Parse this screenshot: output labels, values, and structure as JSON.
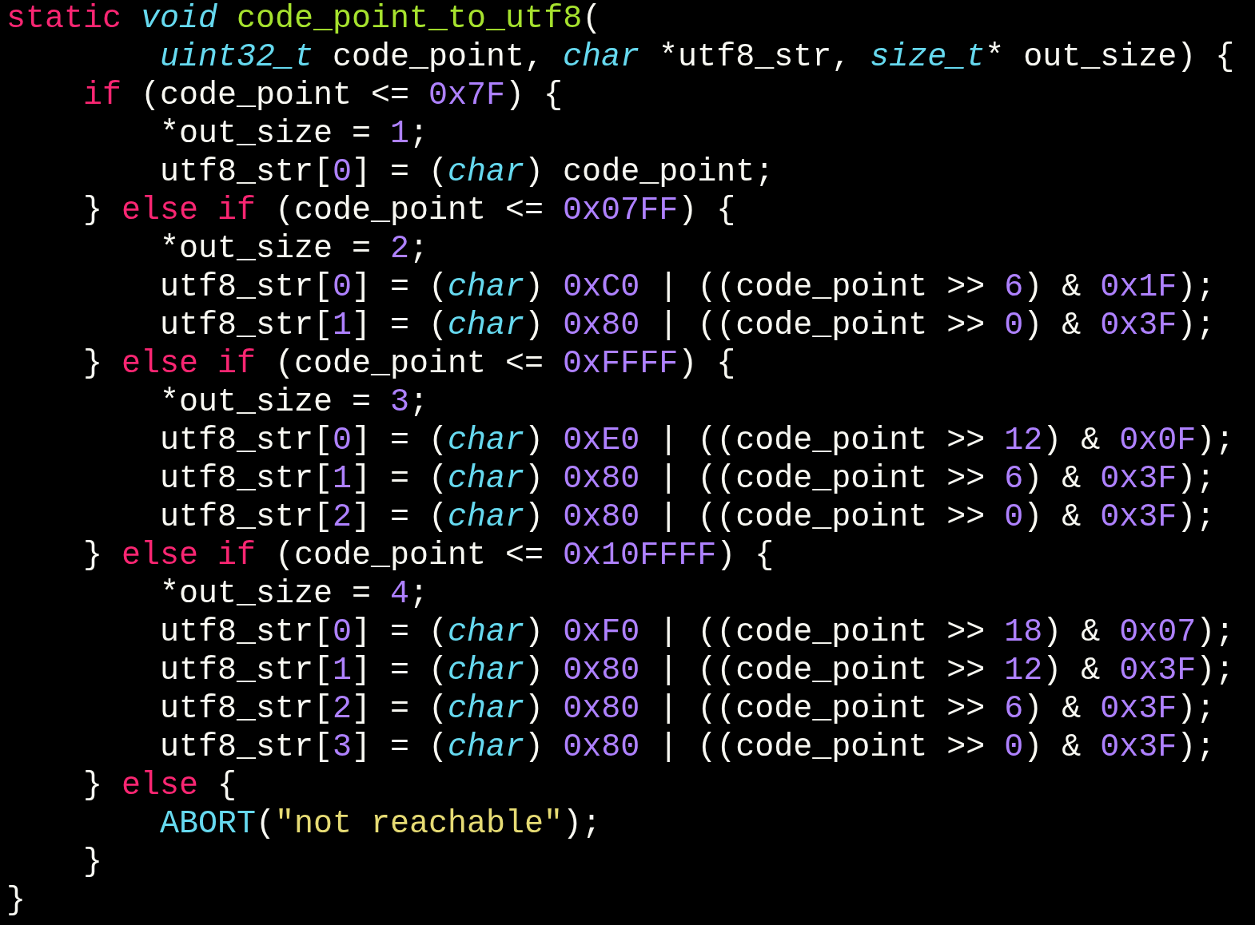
{
  "code_lines": [
    {
      "kind": "top",
      "tokens": [
        {
          "kind": "keyword",
          "text": "static "
        },
        {
          "kind": "type",
          "text": "void "
        },
        {
          "kind": "function",
          "text": "code_point_to_utf8"
        },
        {
          "kind": "plain",
          "text": "("
        }
      ]
    },
    {
      "kind": "inner",
      "tokens": [
        {
          "kind": "type",
          "text": "uint32_t"
        },
        {
          "kind": "plain",
          "text": " code_point, "
        },
        {
          "kind": "type",
          "text": "char"
        },
        {
          "kind": "plain",
          "text": " *utf8_str, "
        },
        {
          "kind": "type",
          "text": "size_t"
        },
        {
          "kind": "plain",
          "text": "* out_size) {"
        }
      ]
    },
    {
      "kind": "outer",
      "tokens": [
        {
          "kind": "keyword",
          "text": "if "
        },
        {
          "kind": "plain",
          "text": "(code_point <= "
        },
        {
          "kind": "number",
          "text": "0x7F"
        },
        {
          "kind": "plain",
          "text": ") {"
        }
      ]
    },
    {
      "kind": "inner",
      "tokens": [
        {
          "kind": "plain",
          "text": "*out_size = "
        },
        {
          "kind": "number",
          "text": "1"
        },
        {
          "kind": "plain",
          "text": ";"
        }
      ]
    },
    {
      "kind": "inner",
      "tokens": [
        {
          "kind": "plain",
          "text": "utf8_str["
        },
        {
          "kind": "number",
          "text": "0"
        },
        {
          "kind": "plain",
          "text": "] = ("
        },
        {
          "kind": "type",
          "text": "char"
        },
        {
          "kind": "plain",
          "text": ") code_point;"
        }
      ]
    },
    {
      "kind": "outer",
      "tokens": [
        {
          "kind": "plain",
          "text": "} "
        },
        {
          "kind": "keyword",
          "text": "else if "
        },
        {
          "kind": "plain",
          "text": "(code_point <= "
        },
        {
          "kind": "number",
          "text": "0x07FF"
        },
        {
          "kind": "plain",
          "text": ") {"
        }
      ]
    },
    {
      "kind": "inner",
      "tokens": [
        {
          "kind": "plain",
          "text": "*out_size = "
        },
        {
          "kind": "number",
          "text": "2"
        },
        {
          "kind": "plain",
          "text": ";"
        }
      ]
    },
    {
      "kind": "inner",
      "tokens": [
        {
          "kind": "plain",
          "text": "utf8_str["
        },
        {
          "kind": "number",
          "text": "0"
        },
        {
          "kind": "plain",
          "text": "] = ("
        },
        {
          "kind": "type",
          "text": "char"
        },
        {
          "kind": "plain",
          "text": ") "
        },
        {
          "kind": "number",
          "text": "0xC0"
        },
        {
          "kind": "plain",
          "text": " | ((code_point >> "
        },
        {
          "kind": "number",
          "text": "6"
        },
        {
          "kind": "plain",
          "text": ") & "
        },
        {
          "kind": "number",
          "text": "0x1F"
        },
        {
          "kind": "plain",
          "text": ");"
        }
      ]
    },
    {
      "kind": "inner",
      "tokens": [
        {
          "kind": "plain",
          "text": "utf8_str["
        },
        {
          "kind": "number",
          "text": "1"
        },
        {
          "kind": "plain",
          "text": "] = ("
        },
        {
          "kind": "type",
          "text": "char"
        },
        {
          "kind": "plain",
          "text": ") "
        },
        {
          "kind": "number",
          "text": "0x80"
        },
        {
          "kind": "plain",
          "text": " | ((code_point >> "
        },
        {
          "kind": "number",
          "text": "0"
        },
        {
          "kind": "plain",
          "text": ") & "
        },
        {
          "kind": "number",
          "text": "0x3F"
        },
        {
          "kind": "plain",
          "text": ");"
        }
      ]
    },
    {
      "kind": "outer",
      "tokens": [
        {
          "kind": "plain",
          "text": "} "
        },
        {
          "kind": "keyword",
          "text": "else if "
        },
        {
          "kind": "plain",
          "text": "(code_point <= "
        },
        {
          "kind": "number",
          "text": "0xFFFF"
        },
        {
          "kind": "plain",
          "text": ") {"
        }
      ]
    },
    {
      "kind": "inner",
      "tokens": [
        {
          "kind": "plain",
          "text": "*out_size = "
        },
        {
          "kind": "number",
          "text": "3"
        },
        {
          "kind": "plain",
          "text": ";"
        }
      ]
    },
    {
      "kind": "inner",
      "tokens": [
        {
          "kind": "plain",
          "text": "utf8_str["
        },
        {
          "kind": "number",
          "text": "0"
        },
        {
          "kind": "plain",
          "text": "] = ("
        },
        {
          "kind": "type",
          "text": "char"
        },
        {
          "kind": "plain",
          "text": ") "
        },
        {
          "kind": "number",
          "text": "0xE0"
        },
        {
          "kind": "plain",
          "text": " | ((code_point >> "
        },
        {
          "kind": "number",
          "text": "12"
        },
        {
          "kind": "plain",
          "text": ") & "
        },
        {
          "kind": "number",
          "text": "0x0F"
        },
        {
          "kind": "plain",
          "text": ");"
        }
      ]
    },
    {
      "kind": "inner",
      "tokens": [
        {
          "kind": "plain",
          "text": "utf8_str["
        },
        {
          "kind": "number",
          "text": "1"
        },
        {
          "kind": "plain",
          "text": "] = ("
        },
        {
          "kind": "type",
          "text": "char"
        },
        {
          "kind": "plain",
          "text": ") "
        },
        {
          "kind": "number",
          "text": "0x80"
        },
        {
          "kind": "plain",
          "text": " | ((code_point >> "
        },
        {
          "kind": "number",
          "text": "6"
        },
        {
          "kind": "plain",
          "text": ") & "
        },
        {
          "kind": "number",
          "text": "0x3F"
        },
        {
          "kind": "plain",
          "text": ");"
        }
      ]
    },
    {
      "kind": "inner",
      "tokens": [
        {
          "kind": "plain",
          "text": "utf8_str["
        },
        {
          "kind": "number",
          "text": "2"
        },
        {
          "kind": "plain",
          "text": "] = ("
        },
        {
          "kind": "type",
          "text": "char"
        },
        {
          "kind": "plain",
          "text": ") "
        },
        {
          "kind": "number",
          "text": "0x80"
        },
        {
          "kind": "plain",
          "text": " | ((code_point >> "
        },
        {
          "kind": "number",
          "text": "0"
        },
        {
          "kind": "plain",
          "text": ") & "
        },
        {
          "kind": "number",
          "text": "0x3F"
        },
        {
          "kind": "plain",
          "text": ");"
        }
      ]
    },
    {
      "kind": "outer",
      "tokens": [
        {
          "kind": "plain",
          "text": "} "
        },
        {
          "kind": "keyword",
          "text": "else if "
        },
        {
          "kind": "plain",
          "text": "(code_point <= "
        },
        {
          "kind": "number",
          "text": "0x10FFFF"
        },
        {
          "kind": "plain",
          "text": ") {"
        }
      ]
    },
    {
      "kind": "inner",
      "tokens": [
        {
          "kind": "plain",
          "text": "*out_size = "
        },
        {
          "kind": "number",
          "text": "4"
        },
        {
          "kind": "plain",
          "text": ";"
        }
      ]
    },
    {
      "kind": "inner",
      "tokens": [
        {
          "kind": "plain",
          "text": "utf8_str["
        },
        {
          "kind": "number",
          "text": "0"
        },
        {
          "kind": "plain",
          "text": "] = ("
        },
        {
          "kind": "type",
          "text": "char"
        },
        {
          "kind": "plain",
          "text": ") "
        },
        {
          "kind": "number",
          "text": "0xF0"
        },
        {
          "kind": "plain",
          "text": " | ((code_point >> "
        },
        {
          "kind": "number",
          "text": "18"
        },
        {
          "kind": "plain",
          "text": ") & "
        },
        {
          "kind": "number",
          "text": "0x07"
        },
        {
          "kind": "plain",
          "text": ");"
        }
      ]
    },
    {
      "kind": "inner",
      "tokens": [
        {
          "kind": "plain",
          "text": "utf8_str["
        },
        {
          "kind": "number",
          "text": "1"
        },
        {
          "kind": "plain",
          "text": "] = ("
        },
        {
          "kind": "type",
          "text": "char"
        },
        {
          "kind": "plain",
          "text": ") "
        },
        {
          "kind": "number",
          "text": "0x80"
        },
        {
          "kind": "plain",
          "text": " | ((code_point >> "
        },
        {
          "kind": "number",
          "text": "12"
        },
        {
          "kind": "plain",
          "text": ") & "
        },
        {
          "kind": "number",
          "text": "0x3F"
        },
        {
          "kind": "plain",
          "text": ");"
        }
      ]
    },
    {
      "kind": "inner",
      "tokens": [
        {
          "kind": "plain",
          "text": "utf8_str["
        },
        {
          "kind": "number",
          "text": "2"
        },
        {
          "kind": "plain",
          "text": "] = ("
        },
        {
          "kind": "type",
          "text": "char"
        },
        {
          "kind": "plain",
          "text": ") "
        },
        {
          "kind": "number",
          "text": "0x80"
        },
        {
          "kind": "plain",
          "text": " | ((code_point >> "
        },
        {
          "kind": "number",
          "text": "6"
        },
        {
          "kind": "plain",
          "text": ") & "
        },
        {
          "kind": "number",
          "text": "0x3F"
        },
        {
          "kind": "plain",
          "text": ");"
        }
      ]
    },
    {
      "kind": "inner",
      "tokens": [
        {
          "kind": "plain",
          "text": "utf8_str["
        },
        {
          "kind": "number",
          "text": "3"
        },
        {
          "kind": "plain",
          "text": "] = ("
        },
        {
          "kind": "type",
          "text": "char"
        },
        {
          "kind": "plain",
          "text": ") "
        },
        {
          "kind": "number",
          "text": "0x80"
        },
        {
          "kind": "plain",
          "text": " | ((code_point >> "
        },
        {
          "kind": "number",
          "text": "0"
        },
        {
          "kind": "plain",
          "text": ") & "
        },
        {
          "kind": "number",
          "text": "0x3F"
        },
        {
          "kind": "plain",
          "text": ");"
        }
      ]
    },
    {
      "kind": "outer",
      "tokens": [
        {
          "kind": "plain",
          "text": "} "
        },
        {
          "kind": "keyword",
          "text": "else "
        },
        {
          "kind": "plain",
          "text": "{"
        }
      ]
    },
    {
      "kind": "inner",
      "tokens": [
        {
          "kind": "call",
          "text": "ABORT"
        },
        {
          "kind": "plain",
          "text": "("
        },
        {
          "kind": "string",
          "text": "\"not reachable\""
        },
        {
          "kind": "plain",
          "text": ");"
        }
      ]
    },
    {
      "kind": "outer",
      "tokens": [
        {
          "kind": "plain",
          "text": "}"
        }
      ]
    },
    {
      "kind": "top",
      "tokens": [
        {
          "kind": "plain",
          "text": "}"
        }
      ]
    }
  ]
}
